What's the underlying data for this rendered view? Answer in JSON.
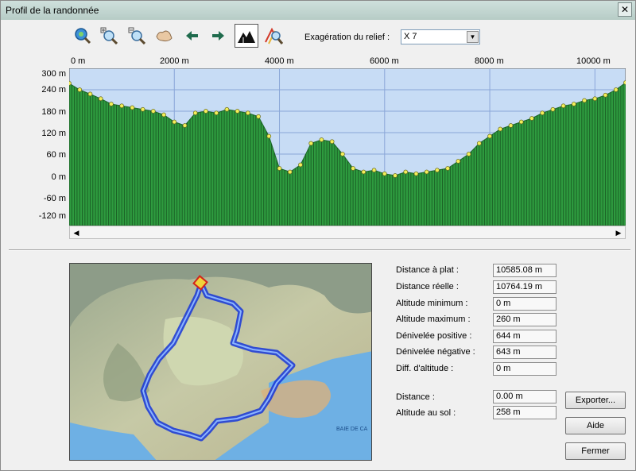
{
  "window": {
    "title": "Profil de la randonnée"
  },
  "toolbar": {
    "exaggeration_label": "Exagération du relief :",
    "exaggeration_value": "X 7",
    "buttons": [
      "zoom-fit-icon",
      "zoom-in-icon",
      "zoom-out-icon",
      "pan-hand-icon",
      "arrow-left-icon",
      "arrow-right-icon",
      "terrain-icon",
      "profile-search-icon"
    ]
  },
  "chart_data": {
    "type": "area",
    "x_ticks": [
      "0 m",
      "2000 m",
      "4000 m",
      "6000 m",
      "8000 m",
      "10000 m"
    ],
    "y_ticks": [
      "300 m",
      "240 m",
      "180 m",
      "120 m",
      "60 m",
      "0 m",
      "-60 m",
      "-120 m"
    ],
    "xlim": [
      0,
      10585
    ],
    "ylim": [
      -140,
      300
    ],
    "grid": true,
    "x": [
      0,
      200,
      400,
      600,
      800,
      1000,
      1200,
      1400,
      1600,
      1800,
      2000,
      2200,
      2400,
      2600,
      2800,
      3000,
      3200,
      3400,
      3600,
      3800,
      4000,
      4200,
      4400,
      4600,
      4800,
      5000,
      5200,
      5400,
      5600,
      5800,
      6000,
      6200,
      6400,
      6600,
      6800,
      7000,
      7200,
      7400,
      7600,
      7800,
      8000,
      8200,
      8400,
      8600,
      8800,
      9000,
      9200,
      9400,
      9600,
      9800,
      10000,
      10200,
      10400,
      10585
    ],
    "y": [
      258,
      240,
      228,
      215,
      200,
      195,
      190,
      185,
      180,
      170,
      150,
      140,
      175,
      180,
      175,
      185,
      180,
      175,
      165,
      110,
      20,
      10,
      30,
      90,
      100,
      95,
      60,
      20,
      10,
      15,
      5,
      0,
      10,
      5,
      10,
      15,
      20,
      40,
      60,
      90,
      110,
      130,
      140,
      150,
      160,
      175,
      185,
      195,
      200,
      210,
      215,
      225,
      240,
      260
    ],
    "colors": {
      "fill": "#2e9b3f",
      "sky": "#c7dcf5",
      "marker": "#f2ef5a",
      "grid": "#8aa6d8"
    }
  },
  "stats": {
    "flat_distance": {
      "label": "Distance à plat :",
      "value": "10585.08 m"
    },
    "real_distance": {
      "label": "Distance réelle :",
      "value": "10764.19 m"
    },
    "min_alt": {
      "label": "Altitude minimum :",
      "value": "0 m"
    },
    "max_alt": {
      "label": "Altitude maximum :",
      "value": "260 m"
    },
    "pos_gain": {
      "label": "Dénivelée positive :",
      "value": "644 m"
    },
    "neg_gain": {
      "label": "Dénivelée négative :",
      "value": "643 m"
    },
    "alt_diff": {
      "label": "Diff. d'altitude :",
      "value": "0 m"
    },
    "distance": {
      "label": "Distance :",
      "value": "0.00 m"
    },
    "ground_alt": {
      "label": "Altitude au sol :",
      "value": "258 m"
    }
  },
  "buttons": {
    "export": "Exporter...",
    "help": "Aide",
    "close": "Fermer"
  },
  "map": {
    "labels": [
      "BAIE DE CA"
    ]
  }
}
